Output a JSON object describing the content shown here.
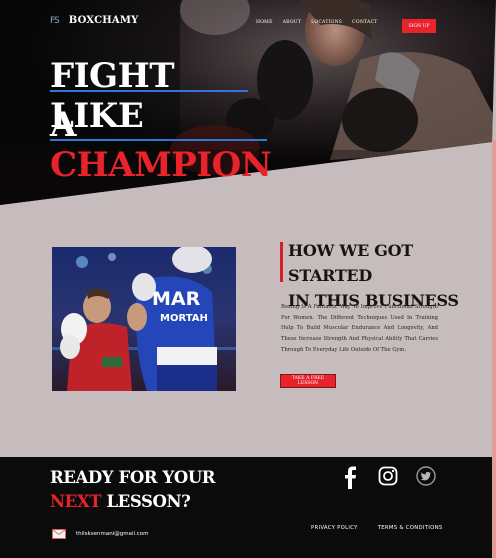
{
  "brand": {
    "mark": "FS",
    "name": "BOXCHAMY"
  },
  "nav": {
    "items": [
      "HOME",
      "ABOUT",
      "LOCATIONS",
      "CONTACT"
    ],
    "signup": "SIGN UP"
  },
  "hero": {
    "line1": "FIGHT LIKE",
    "line2_white": "A",
    "line2_red": "CHAMPION"
  },
  "about": {
    "title_line1": "HOW  WE GOT STARTED",
    "title_line2": "IN THIS BUSINESS",
    "body": "Boxing Is A Fantastic Way To Improve Functional Strength For Women. The Different Techniques Used In Training Help To Build Muscular Endurance And Longevity, And These Increase Strength And Physical Ability That Carries Through To Everyday Life Outside Of The Gym.",
    "button": "TAKE A FREE LESSON",
    "photo_text_1": "MAR",
    "photo_text_2": "MORTAH"
  },
  "footer": {
    "ready_line1": "READY FOR YOUR",
    "ready_red": "NEXT",
    "ready_rest": " LESSON?",
    "email": "thilsksenmani@gmail.com",
    "links": [
      "PRIVACY POLICY",
      "TERMS & CONDITIONS"
    ]
  },
  "colors": {
    "accent_red": "#e8232b",
    "accent_blue": "#2f78d6",
    "page_bg": "#c6bcbd",
    "footer_bg": "#0b0b0b"
  }
}
